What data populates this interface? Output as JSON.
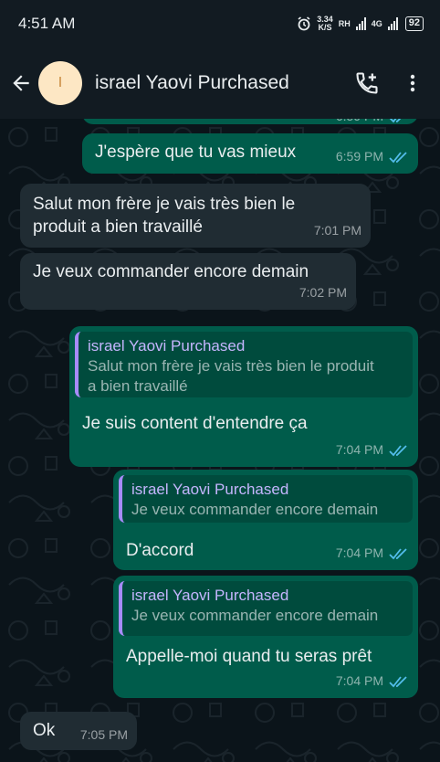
{
  "status_bar": {
    "time": "4:51 AM",
    "speed_value": "3.34",
    "speed_unit": "K/S",
    "network1": "RH",
    "network2": "4G",
    "battery": "92"
  },
  "header": {
    "avatar_letter": "I",
    "contact_name": "israel Yaovi Purchased",
    "icons": [
      "back-arrow-icon",
      "add-call-icon",
      "more-vert-icon"
    ]
  },
  "messages": [
    {
      "kind": "out",
      "text": "",
      "time": "6:59 PM",
      "partial": true
    },
    {
      "kind": "out",
      "text": "J'espère que tu vas mieux",
      "time": "6:59 PM"
    },
    {
      "kind": "in",
      "line1": "Salut mon frère je vais très bien le",
      "line2": "produit a bien travaillé",
      "time": "7:01 PM"
    },
    {
      "kind": "in",
      "text": "Je veux commander encore demain",
      "time": "7:02 PM"
    },
    {
      "kind": "out",
      "quote_author": "israel Yaovi Purchased",
      "quote_line1": "Salut mon frère je vais très bien le produit",
      "quote_line2": "a bien travaillé",
      "text": "Je suis content d'entendre ça",
      "time": "7:04 PM"
    },
    {
      "kind": "out",
      "quote_author": "israel Yaovi Purchased",
      "quote_text": "Je veux commander encore demain",
      "text": "D'accord",
      "time": "7:04 PM"
    },
    {
      "kind": "out",
      "quote_author": "israel Yaovi Purchased",
      "quote_text": "Je veux commander encore demain",
      "text": "Appelle-moi quand tu seras prêt",
      "time": "7:04 PM"
    },
    {
      "kind": "in",
      "text": "Ok",
      "time": "7:05 PM"
    }
  ],
  "colors": {
    "outgoing_bubble": "#005c4b",
    "incoming_bubble": "#202c33",
    "read_ticks": "#53bdeb",
    "quote_author": "#c4b5fd"
  }
}
